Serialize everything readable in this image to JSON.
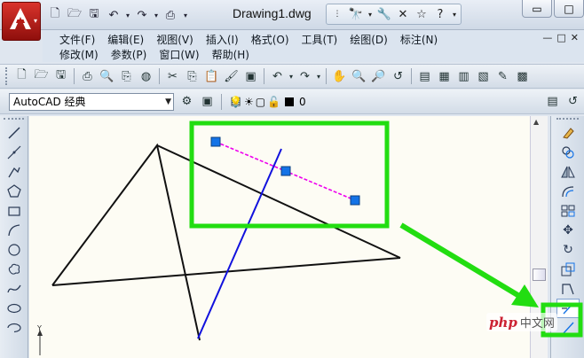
{
  "window": {
    "doc_title": "Drawing1.dwg",
    "win_buttons": [
      "▭",
      "□",
      "✕"
    ]
  },
  "menus": {
    "row1": [
      "文件(F)",
      "编辑(E)",
      "视图(V)",
      "插入(I)",
      "格式(O)",
      "工具(T)",
      "绘图(D)",
      "标注(N)"
    ],
    "row2": [
      "修改(M)",
      "参数(P)",
      "窗口(W)",
      "帮助(H)"
    ],
    "doc_controls": [
      "—",
      "□",
      "✕"
    ]
  },
  "toolbar": {
    "workspace": "AutoCAD 经典",
    "layer_name": "0"
  },
  "watermark": {
    "brand": "php",
    "site": "中文网"
  },
  "accent": {
    "app_red": "#c0201b",
    "highlight_green": "#22dd11",
    "grip_blue": "#1473e6",
    "selected_line": "#ee00ee",
    "line_blue": "#1111dd"
  },
  "icons": {
    "left_draw": [
      "line-icon",
      "construction-line-icon",
      "polyline-icon",
      "polygon-icon",
      "rectangle-icon",
      "arc-icon",
      "circle-icon",
      "revision-cloud-icon",
      "spline-icon",
      "ellipse-icon",
      "ellipse-arc-icon"
    ],
    "right_modify": [
      "erase-icon",
      "copy-icon",
      "mirror-icon",
      "offset-icon",
      "array-icon",
      "move-icon",
      "rotate-icon",
      "scale-icon",
      "stretch-icon",
      "trim-icon",
      "extend-icon"
    ]
  }
}
